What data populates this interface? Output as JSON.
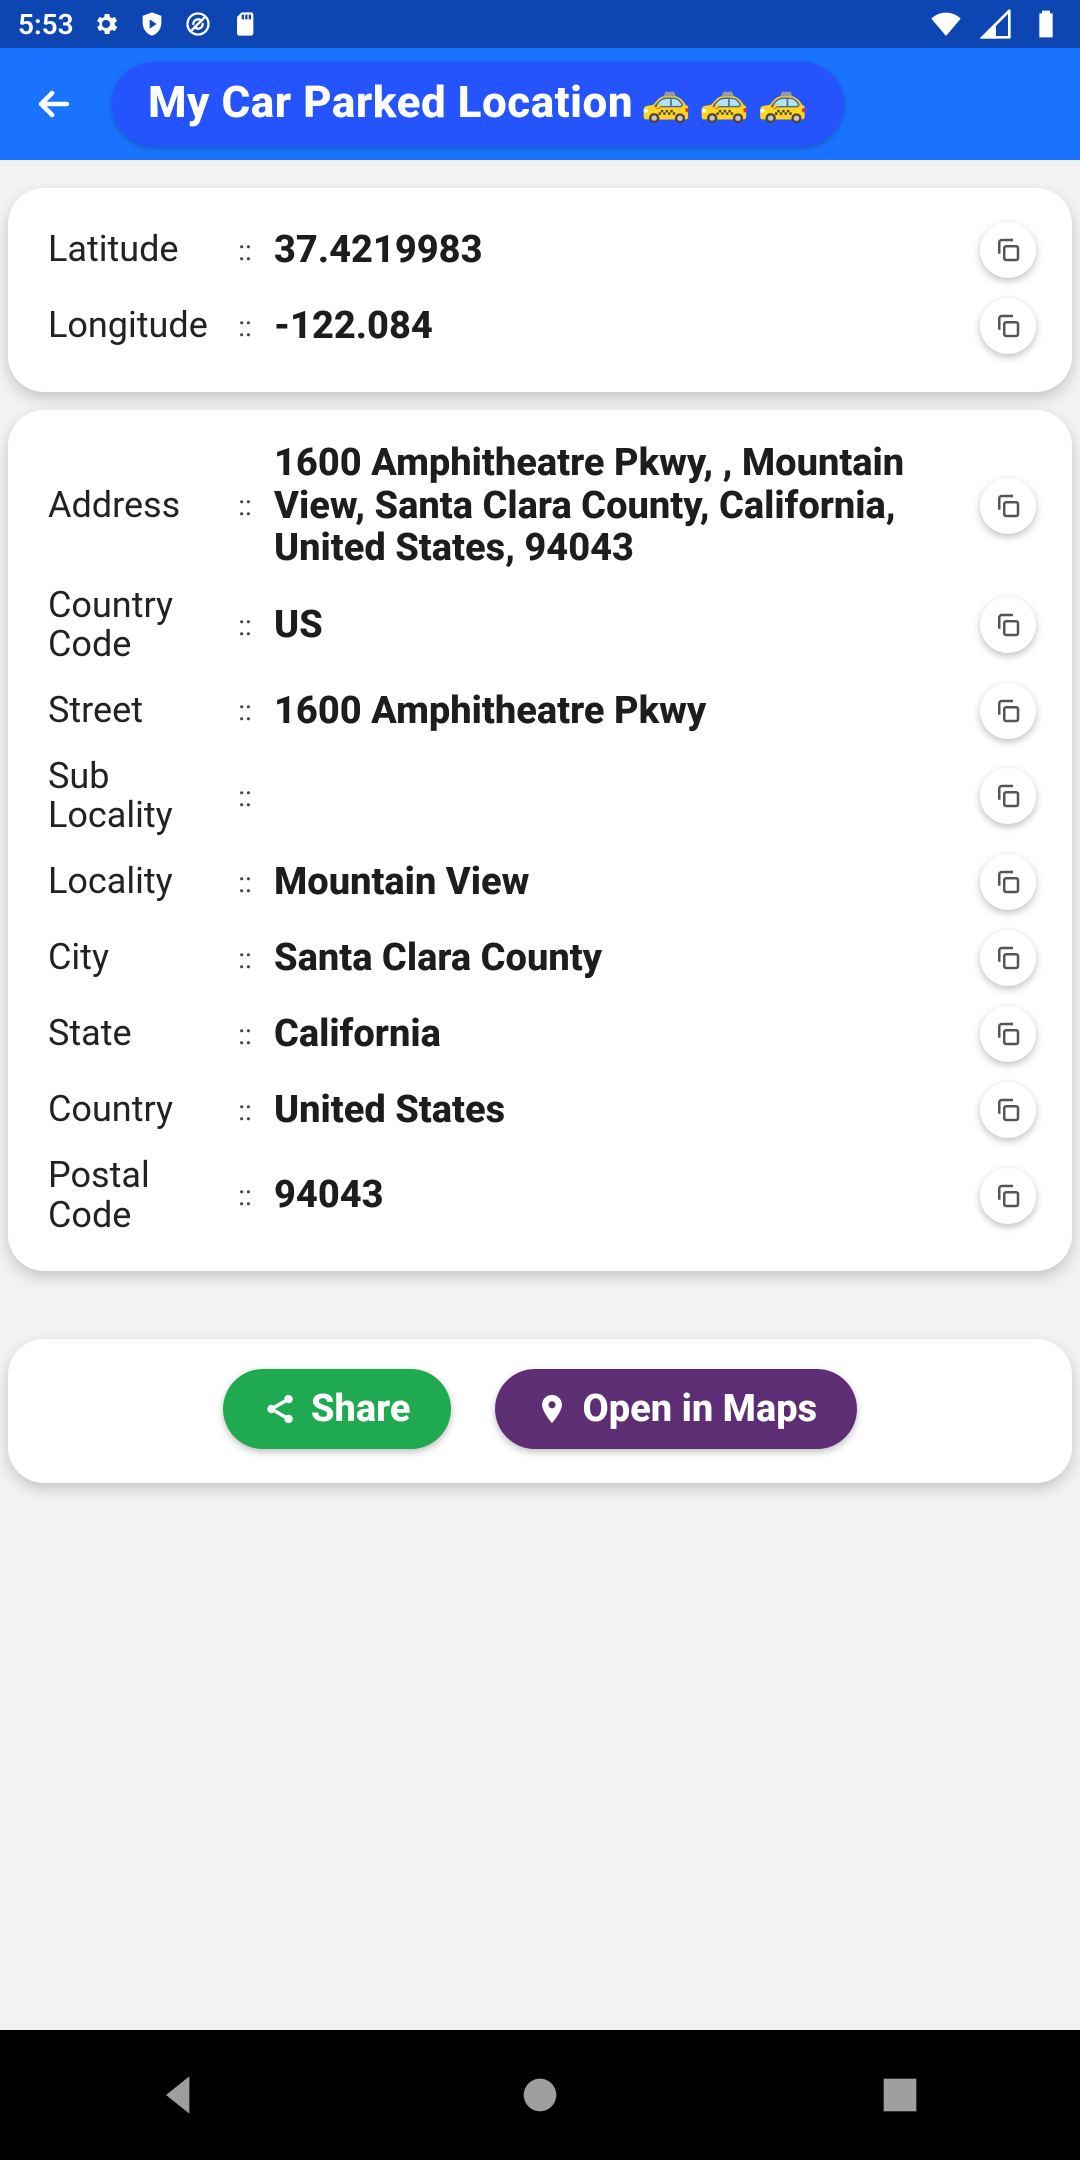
{
  "status_bar": {
    "time": "5:53"
  },
  "app_bar": {
    "title": "My Car Parked Location"
  },
  "coords": {
    "lat_label": "Latitude",
    "lat_value": "37.4219983",
    "lon_label": "Longitude",
    "lon_value": "-122.084"
  },
  "details": {
    "address_label": "Address",
    "address_value": "1600 Amphitheatre Pkwy, , Mountain View, Santa Clara County, California, United States, 94043",
    "country_code_label": "Country Code",
    "country_code_value": "US",
    "street_label": "Street",
    "street_value": "1600 Amphitheatre Pkwy",
    "sublocality_label": "Sub Locality",
    "sublocality_value": "",
    "locality_label": "Locality",
    "locality_value": "Mountain View",
    "city_label": "City",
    "city_value": "Santa Clara County",
    "state_label": "State",
    "state_value": "California",
    "country_label": "Country",
    "country_value": "United States",
    "postal_label": "Postal Code",
    "postal_value": "94043"
  },
  "actions": {
    "share_label": "Share",
    "maps_label": "Open in Maps"
  },
  "misc": {
    "sep": "::"
  }
}
